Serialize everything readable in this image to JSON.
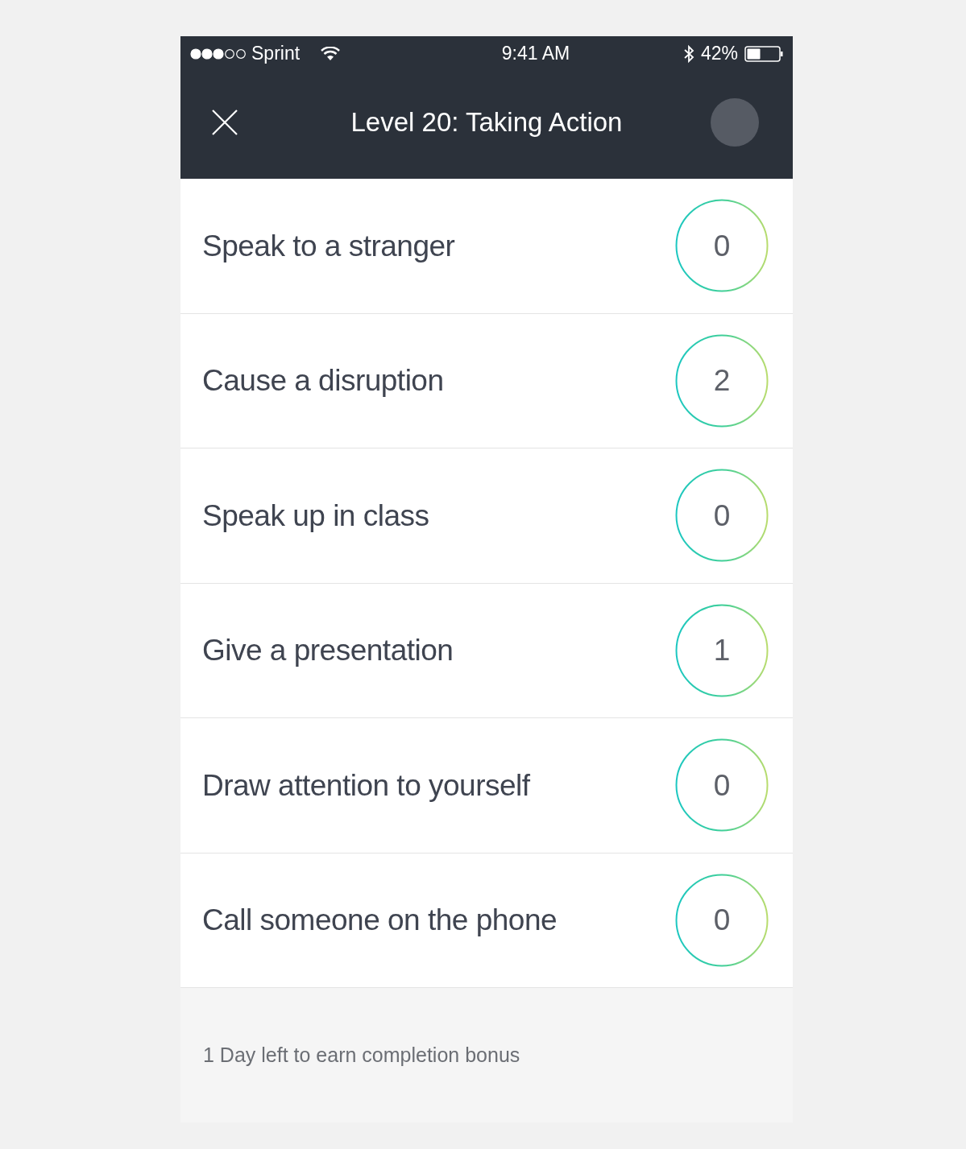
{
  "status_bar": {
    "carrier": "Sprint",
    "time": "9:41 AM",
    "battery": "42%"
  },
  "nav": {
    "title": "Level 20: Taking Action"
  },
  "tasks": [
    {
      "label": "Speak to a stranger",
      "count": "0"
    },
    {
      "label": "Cause a disruption",
      "count": "2"
    },
    {
      "label": "Speak up in class",
      "count": "0"
    },
    {
      "label": "Give a presentation",
      "count": "1"
    },
    {
      "label": "Draw attention to yourself",
      "count": "0"
    },
    {
      "label": "Call someone on the phone",
      "count": "0"
    }
  ],
  "footer": {
    "text": "1 Day left to earn completion bonus"
  }
}
